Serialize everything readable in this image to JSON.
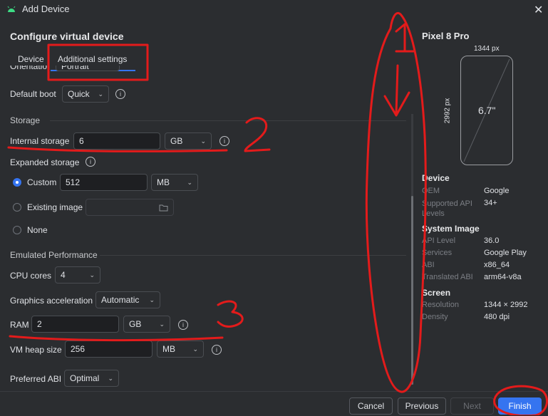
{
  "window": {
    "title": "Add Device",
    "close_glyph": "✕",
    "app_icon": "android-icon"
  },
  "header": {
    "title": "Configure virtual device"
  },
  "tabs": [
    {
      "label": "Device",
      "selected": false
    },
    {
      "label": "Additional settings",
      "selected": true
    }
  ],
  "form": {
    "orientation_partial": "Orientatio",
    "orientation_value_partial": "Portrait",
    "default_boot": {
      "label": "Default boot",
      "value": "Quick"
    },
    "storage": {
      "section": "Storage",
      "internal": {
        "label": "Internal storage",
        "value": "6",
        "unit": "GB"
      },
      "expanded": {
        "label": "Expanded storage",
        "options": [
          {
            "label": "Custom",
            "selected": true,
            "value": "512",
            "unit": "MB"
          },
          {
            "label": "Existing image",
            "selected": false,
            "value": ""
          },
          {
            "label": "None",
            "selected": false
          }
        ]
      }
    },
    "performance": {
      "section": "Emulated Performance",
      "cpu_cores": {
        "label": "CPU cores",
        "value": "4"
      },
      "graphics": {
        "label": "Graphics acceleration",
        "value": "Automatic"
      },
      "ram": {
        "label": "RAM",
        "value": "2",
        "unit": "GB"
      },
      "vm_heap": {
        "label": "VM heap size",
        "value": "256",
        "unit": "MB"
      },
      "preferred_abi": {
        "label": "Preferred ABI",
        "value": "Optimal"
      }
    }
  },
  "preview": {
    "device_name": "Pixel 8 Pro",
    "width_label": "1344 px",
    "height_label": "2992 px",
    "size_label": "6.7\"",
    "sections": [
      {
        "title": "Device",
        "rows": [
          {
            "key": "OEM",
            "value": "Google"
          },
          {
            "key": "Supported API Levels",
            "value": "34+"
          }
        ]
      },
      {
        "title": "System Image",
        "rows": [
          {
            "key": "API Level",
            "value": "36.0"
          },
          {
            "key": "Services",
            "value": "Google Play"
          },
          {
            "key": "ABI",
            "value": "x86_64"
          },
          {
            "key": "Translated ABI",
            "value": "arm64-v8a"
          }
        ]
      },
      {
        "title": "Screen",
        "rows": [
          {
            "key": "Resolution",
            "value": "1344 × 2992"
          },
          {
            "key": "Density",
            "value": "480 dpi"
          }
        ]
      }
    ]
  },
  "footer": {
    "cancel": "Cancel",
    "previous": "Previous",
    "next": "Next",
    "finish": "Finish"
  },
  "annotations": {
    "mark1": "1",
    "mark2": "2",
    "mark3": "3",
    "color": "#e31b1b"
  },
  "colors": {
    "accent": "#3574f0",
    "background": "#2b2d30",
    "field": "#1e1f22"
  },
  "icons": {
    "info": "info-icon",
    "folder": "folder-icon",
    "chevron": "chevron-down-icon"
  }
}
